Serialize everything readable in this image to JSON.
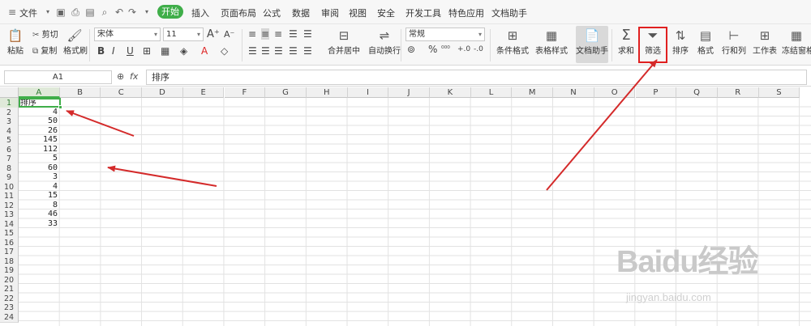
{
  "menubar": {
    "file_label": "文件",
    "items": [
      "开始",
      "插入",
      "页面布局",
      "公式",
      "数据",
      "审阅",
      "视图",
      "安全",
      "开发工具",
      "特色应用",
      "文档助手"
    ]
  },
  "ribbon": {
    "paste": "粘贴",
    "cut": "剪切",
    "copy": "复制",
    "format_painter": "格式刷",
    "font_name": "宋体",
    "font_size": "11",
    "bold": "B",
    "italic": "I",
    "underline": "U",
    "merge_center": "合并居中",
    "wrap_text": "自动换行",
    "number_format": "常规",
    "percent": "%",
    "conditional_format": "条件格式",
    "table_style": "表格样式",
    "doc_helper": "文档助手",
    "sum": "求和",
    "filter": "筛选",
    "sort": "排序",
    "format": "格式",
    "rows_cols": "行和列",
    "worksheet": "工作表",
    "freeze": "冻结窗格"
  },
  "formula": {
    "cell_ref": "A1",
    "fx": "fx",
    "content": "排序"
  },
  "grid": {
    "columns": [
      "A",
      "B",
      "C",
      "D",
      "E",
      "F",
      "G",
      "H",
      "I",
      "J",
      "K",
      "L",
      "M",
      "N",
      "O",
      "P",
      "Q",
      "R",
      "S"
    ],
    "rows": [
      "1",
      "2",
      "3",
      "4",
      "5",
      "6",
      "7",
      "8",
      "9",
      "10",
      "11",
      "12",
      "13",
      "14",
      "15",
      "16",
      "17",
      "18",
      "19",
      "20",
      "21",
      "22",
      "23",
      "24"
    ],
    "header_cell": "排序",
    "values": [
      "4",
      "50",
      "26",
      "145",
      "112",
      "5",
      "60",
      "3",
      "4",
      "15",
      "8",
      "46",
      "33"
    ]
  },
  "watermark": {
    "logo": "Baidu经验",
    "url": "jingyan.baidu.com"
  },
  "colors": {
    "accent": "#3fae49",
    "arrow": "#d42a2a"
  }
}
